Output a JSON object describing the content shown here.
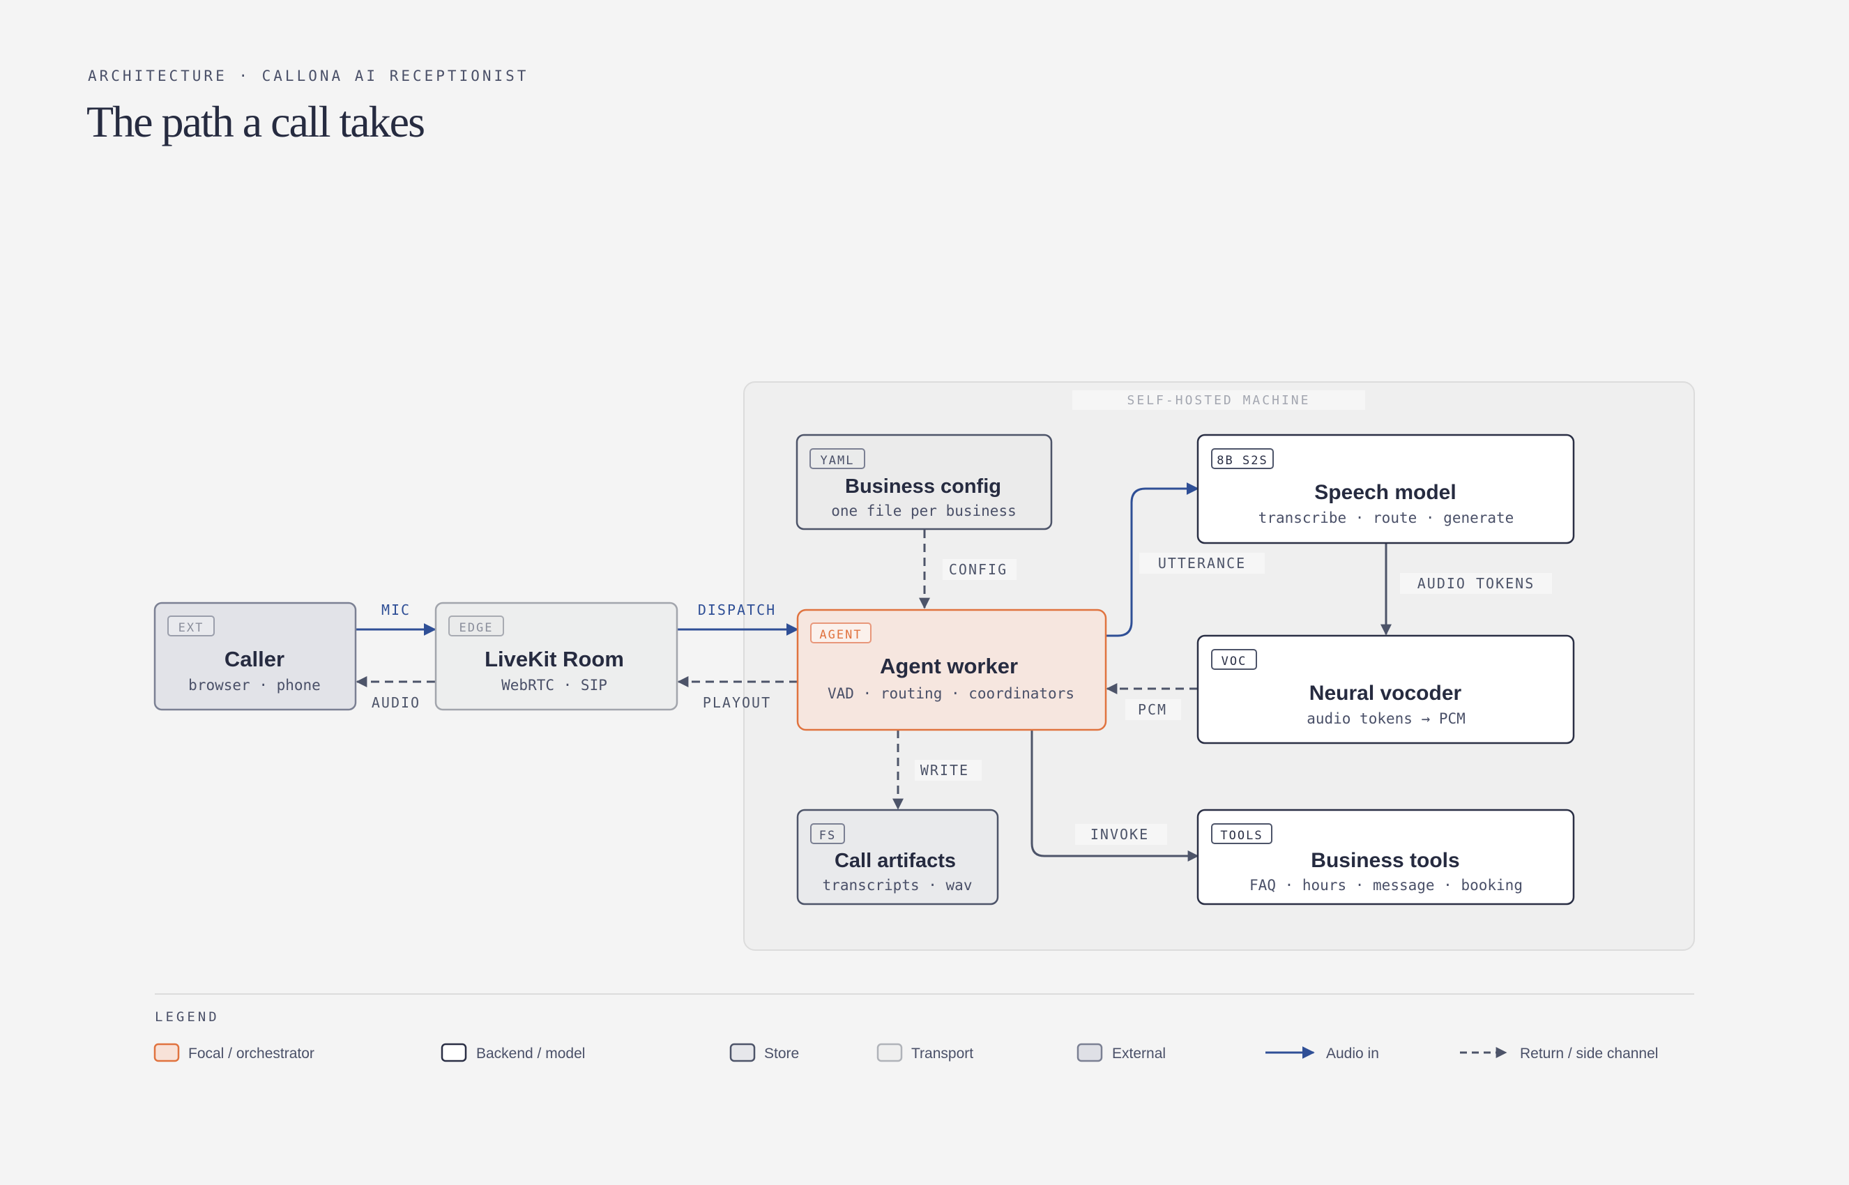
{
  "header": {
    "eyebrow": "ARCHITECTURE · CALLONA AI RECEPTIONIST",
    "title": "The path a call takes"
  },
  "group": {
    "label": "SELF-HOSTED MACHINE"
  },
  "nodes": {
    "caller": {
      "tag": "EXT",
      "title": "Caller",
      "subtitle": "browser · phone"
    },
    "livekit": {
      "tag": "EDGE",
      "title": "LiveKit Room",
      "subtitle": "WebRTC · SIP"
    },
    "config": {
      "tag": "YAML",
      "title": "Business config",
      "subtitle": "one file per business"
    },
    "agent": {
      "tag": "AGENT",
      "title": "Agent worker",
      "subtitle": "VAD · routing · coordinators"
    },
    "artifacts": {
      "tag": "FS",
      "title": "Call artifacts",
      "subtitle": "transcripts · wav"
    },
    "speech": {
      "tag": "8B S2S",
      "title": "Speech model",
      "subtitle": "transcribe · route · generate"
    },
    "vocoder": {
      "tag": "VOC",
      "title": "Neural vocoder",
      "subtitle": "audio tokens → PCM"
    },
    "tools": {
      "tag": "TOOLS",
      "title": "Business tools",
      "subtitle": "FAQ · hours · message · booking"
    }
  },
  "edges": {
    "mic": "MIC",
    "audio": "AUDIO",
    "dispatch": "DISPATCH",
    "playout": "PLAYOUT",
    "config": "CONFIG",
    "write": "WRITE",
    "utterance": "UTTERANCE",
    "audio_tokens": "AUDIO TOKENS",
    "pcm": "PCM",
    "invoke": "INVOKE"
  },
  "legend": {
    "title": "LEGEND",
    "items": {
      "focal": "Focal / orchestrator",
      "backend": "Backend / model",
      "store": "Store",
      "transport": "Transport",
      "external": "External",
      "audio_in": "Audio in",
      "return": "Return / side channel"
    }
  },
  "colors": {
    "background": "#f4f4f4",
    "ink": "#2a2f45",
    "accent_orange": "#e0733f",
    "audio_blue": "#2f4f96",
    "dashed_gray": "#4d5469"
  }
}
